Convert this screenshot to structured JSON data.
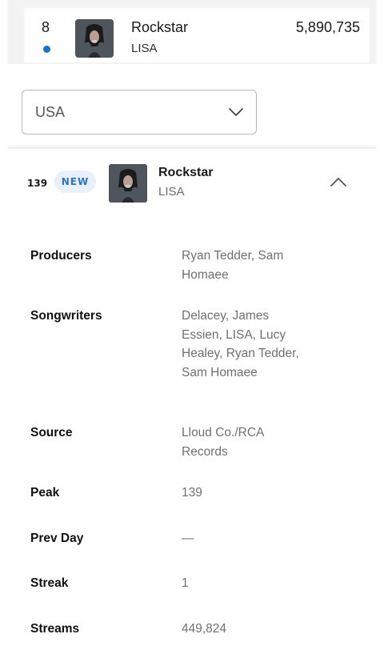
{
  "top_entry": {
    "rank": "8",
    "title": "Rockstar",
    "artist": "LISA",
    "streams": "5,890,735",
    "status_dot_color": "#1e6fc6"
  },
  "country_select": {
    "selected": "USA",
    "icon": "chevron-down-icon"
  },
  "expanded_entry": {
    "rank": "139",
    "badge": "NEW",
    "title": "Rockstar",
    "artist": "LISA",
    "toggle_icon": "chevron-up-icon",
    "details": [
      {
        "label": "Producers",
        "value": "Ryan Tedder, Sam Homaee"
      },
      {
        "label": "Songwriters",
        "value": "Delacey, James Essien, LISA, Lucy Healey, Ryan Tedder, Sam Homaee"
      },
      {
        "label": "Source",
        "value": "Lloud Co./RCA Records"
      },
      {
        "label": "Peak",
        "value": "139"
      },
      {
        "label": "Prev Day",
        "value": "—"
      },
      {
        "label": "Streak",
        "value": "1"
      },
      {
        "label": "Streams",
        "value": "449,824"
      }
    ]
  },
  "colors": {
    "accent_blue": "#2d74c4",
    "badge_bg": "#e7f0fb",
    "muted_text": "#707070"
  }
}
